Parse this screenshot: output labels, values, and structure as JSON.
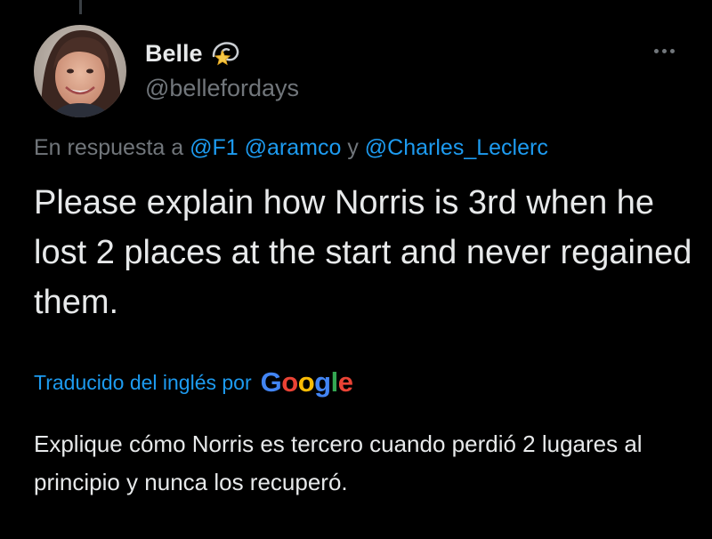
{
  "tweet": {
    "author": {
      "display_name": "Belle",
      "name_emoji": "dizzy-star-icon",
      "handle": "@bellefordays",
      "avatar": "profile-photo"
    },
    "reply_to": {
      "prefix": "En respuesta a",
      "mentions": [
        "@F1",
        "@aramco",
        "@Charles_Leclerc"
      ],
      "conjunction": "y"
    },
    "text": "Please explain how Norris is 3rd when he lost 2 places at the start and never regained them.",
    "translation": {
      "label": "Traducido del inglés por",
      "provider": "Google",
      "text": "Explique cómo Norris es tercero cuando perdió 2 lugares al principio y nunca los recuperó."
    },
    "more_icon": "more-options-icon"
  },
  "colors": {
    "background": "#000000",
    "primary_text": "#e7e9ea",
    "secondary_text": "#71767b",
    "link": "#1d9bf0",
    "google_blue": "#4285F4",
    "google_red": "#EA4335",
    "google_yellow": "#FBBC05",
    "google_green": "#34A853"
  }
}
